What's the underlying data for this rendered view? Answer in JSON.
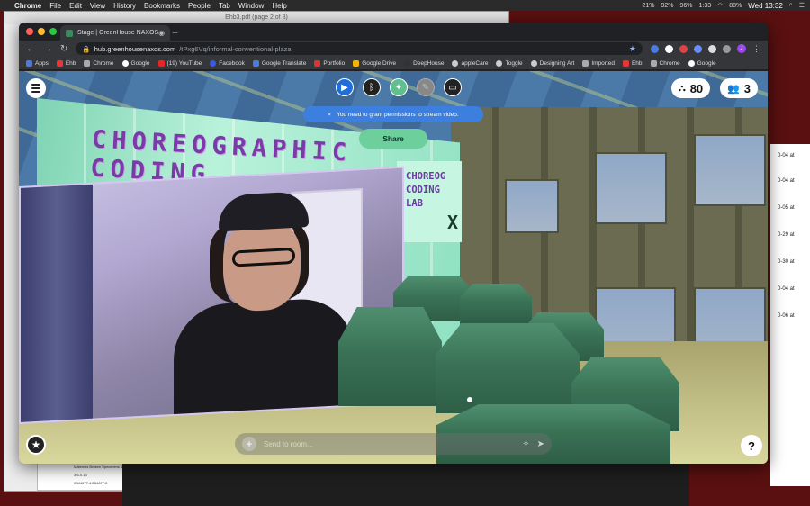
{
  "menubar": {
    "apple": "",
    "items": [
      "Chrome",
      "File",
      "Edit",
      "View",
      "History",
      "Bookmarks",
      "People",
      "Tab",
      "Window",
      "Help"
    ],
    "status": {
      "cpu": "21%",
      "battery_app": "92%",
      "memory": "96%",
      "time_small": "1:33",
      "battery": "88%",
      "clock": "Wed 13:32"
    }
  },
  "pdf_window": {
    "title": "Ehb3.pdf (page 2 of 8)",
    "page_text_left": "Materials Broken Specimens 1.5467",
    "page_text_mid": "3.6-0.13",
    "page_text_right": "0BJ4677.4.2B4677.8"
  },
  "right_doc": {
    "entries": [
      "0-04 at",
      "0-04 at",
      "0-05 at",
      "0-29 at",
      "0-30 at",
      "0-04 at",
      "0-06 at"
    ]
  },
  "browser": {
    "tab_title": "Stage | GreenHouse NAXOS",
    "url_host": "hub.greenhousenaxos.com",
    "url_path": "/tPxg6Vq/informal-conventional-plaza",
    "bookmarks": [
      "Apps",
      "Ehb",
      "Chrome",
      "Google",
      "(19) YouTube",
      "Facebook",
      "Google Translate",
      "Portfolio",
      "Google Drive",
      "DeepHouse",
      "appleCare",
      "Toggle",
      "Designing Art",
      "Imported",
      "Ehb",
      "Chrome",
      "Google"
    ],
    "avatar_letter": "J"
  },
  "hub": {
    "scene_text_main": "CHOREOGRAPHIC\nCODING",
    "scene_text_side": "CHOREOG\nCODING\nLAB",
    "scene_text_x": "X",
    "objects_count": "80",
    "people_count": "3",
    "notice": "You need to grant permissions to stream video.",
    "notice_close": "×",
    "share_label": "Share",
    "chat_placeholder": "Send to room...",
    "help_label": "?"
  },
  "colors": {
    "accent_blue": "#3d7fde",
    "share_green": "#6ccf9c",
    "scene_text_purple": "#7a3aa8"
  }
}
